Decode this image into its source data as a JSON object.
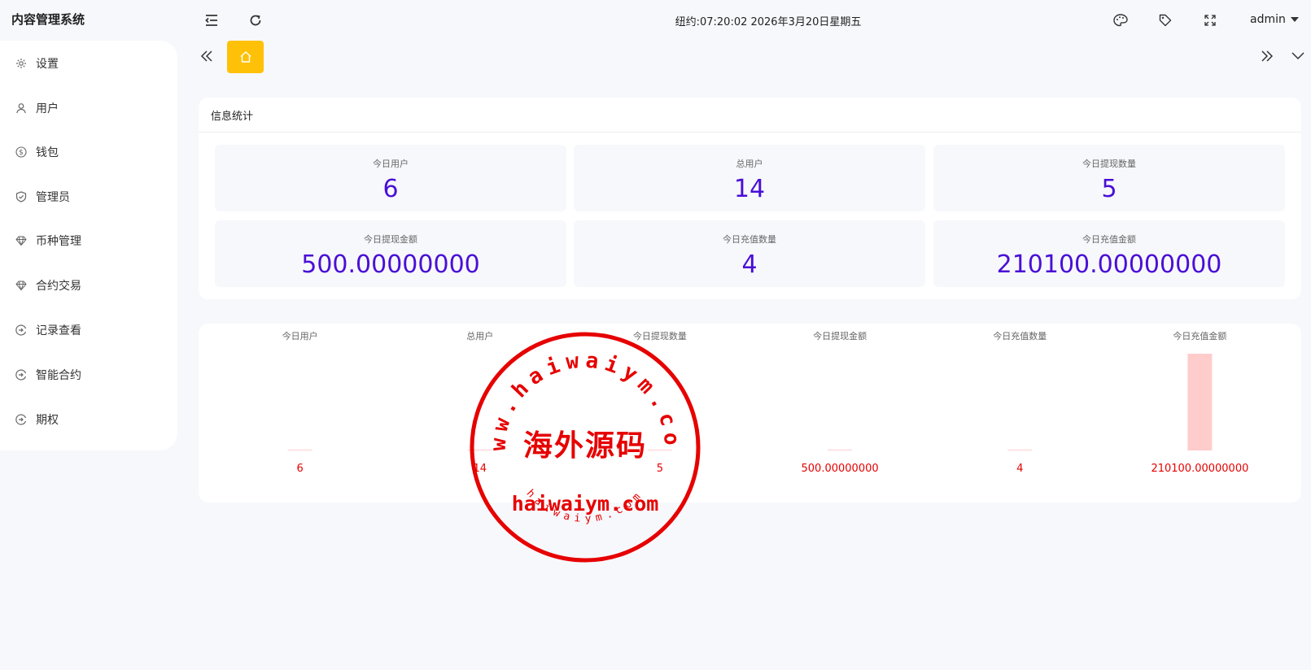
{
  "app": {
    "title": "内容管理系统"
  },
  "header": {
    "clock": "纽约:07:20:02 2026年3月20日星期五",
    "user": "admin"
  },
  "sidebar": {
    "items": [
      {
        "label": "设置",
        "icon": "gear-icon"
      },
      {
        "label": "用户",
        "icon": "user-icon"
      },
      {
        "label": "钱包",
        "icon": "dollar-icon"
      },
      {
        "label": "管理员",
        "icon": "shield-icon"
      },
      {
        "label": "币种管理",
        "icon": "diamond-icon"
      },
      {
        "label": "合约交易",
        "icon": "diamond-icon"
      },
      {
        "label": "记录查看",
        "icon": "record-icon"
      },
      {
        "label": "智能合约",
        "icon": "record-icon"
      },
      {
        "label": "期权",
        "icon": "record-icon"
      }
    ]
  },
  "stats": {
    "title": "信息统计",
    "items": [
      {
        "label": "今日用户",
        "value": "6"
      },
      {
        "label": "总用户",
        "value": "14"
      },
      {
        "label": "今日提现数量",
        "value": "5"
      },
      {
        "label": "今日提现金额",
        "value": "500.00000000"
      },
      {
        "label": "今日充值数量",
        "value": "4"
      },
      {
        "label": "今日充值金额",
        "value": "210100.00000000"
      }
    ]
  },
  "chart_data": {
    "type": "bar",
    "categories": [
      "今日用户",
      "总用户",
      "今日提现数量",
      "今日提现金额",
      "今日充值数量",
      "今日充值金额"
    ],
    "values": [
      6,
      14,
      5,
      500,
      4,
      210100
    ],
    "value_labels": [
      "6",
      "14",
      "5",
      "500.00000000",
      "4",
      "210100.00000000"
    ],
    "bar_color": "#ffcccc",
    "label_color": "#e60000",
    "ylim": [
      0,
      210100
    ],
    "grid": false
  },
  "watermark": {
    "ring_text": "www.haiwaiym.com",
    "center_text": "海外源码",
    "main_text": "haiwaiym.com",
    "bottom_text": "haiwaiym.com",
    "color": "#e60000"
  },
  "colors": {
    "accent": "#4a0fd6",
    "home_tab": "#ffc107"
  }
}
